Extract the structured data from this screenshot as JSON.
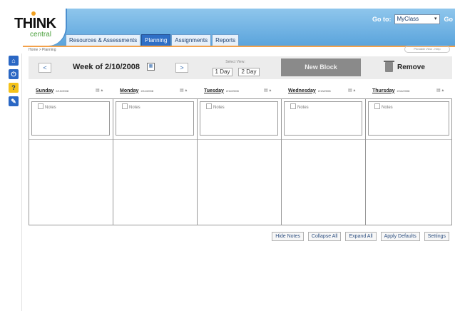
{
  "header": {
    "logo": {
      "word": "THINK",
      "sub": "central"
    },
    "tabs": [
      {
        "label": "Resources & Assessments",
        "active": false
      },
      {
        "label": "Planning",
        "active": true
      },
      {
        "label": "Assignments",
        "active": false
      },
      {
        "label": "Reports",
        "active": false
      }
    ],
    "goto": {
      "label": "Go to:",
      "selected": "MyClass",
      "button": "Go"
    }
  },
  "breadcrumb": "Home > Planning",
  "header_pill": "Printable View - Help",
  "sidebar": {
    "icons": [
      {
        "name": "home-icon",
        "glyph": "⌂"
      },
      {
        "name": "power-icon",
        "glyph": "⏻"
      },
      {
        "name": "help-icon",
        "glyph": "?"
      },
      {
        "name": "tools-icon",
        "glyph": "✎"
      }
    ]
  },
  "toolbar": {
    "prev_label": "<",
    "next_label": ">",
    "week_title": "Week of 2/10/2008",
    "view_label": "Select View:",
    "view_1day": "1 Day",
    "view_2day": "2 Day",
    "new_block": "New Block",
    "remove": "Remove"
  },
  "days": [
    {
      "name": "Sunday",
      "date": "2/10/2008"
    },
    {
      "name": "Monday",
      "date": "2/11/2008"
    },
    {
      "name": "Tuesday",
      "date": "2/12/2008"
    },
    {
      "name": "Wednesday",
      "date": "2/13/2008"
    },
    {
      "name": "Thursday",
      "date": "2/14/2008"
    }
  ],
  "notes_label": "Notes",
  "bottom_buttons": {
    "hide_notes": "Hide Notes",
    "collapse_all": "Collapse All",
    "expand_all": "Expand All",
    "apply_defaults": "Apply Defaults",
    "settings": "Settings"
  },
  "colors": {
    "header_blue": "#5ba4dc",
    "active_tab": "#2f6fc6",
    "accent_orange": "#f3a14a",
    "new_block_gray": "#8a8a8a"
  }
}
